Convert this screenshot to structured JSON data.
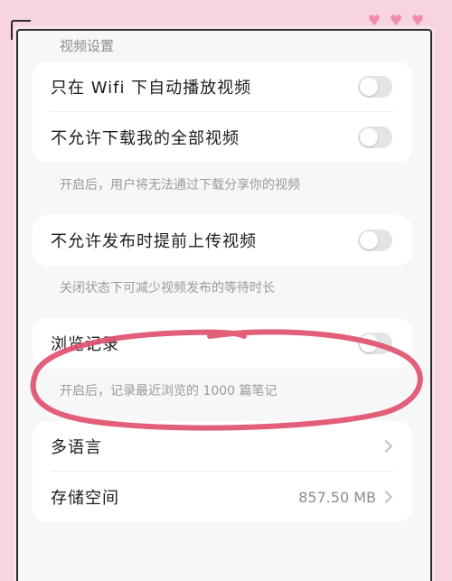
{
  "section_title": "视频设置",
  "card1": {
    "rows": [
      {
        "label": "只在 Wifi 下自动播放视频"
      },
      {
        "label": "不允许下载我的全部视频"
      }
    ]
  },
  "hint1": "开启后，用户将无法通过下载分享你的视频",
  "card2": {
    "rows": [
      {
        "label": "不允许发布时提前上传视频"
      }
    ]
  },
  "hint2": "关闭状态下可减少视频发布的等待时长",
  "card3": {
    "rows": [
      {
        "label": "浏览记录"
      }
    ]
  },
  "hint3": "开启后，记录最近浏览的 1000 篇笔记",
  "card4": {
    "rows": [
      {
        "label": "多语言",
        "value": ""
      },
      {
        "label": "存储空间",
        "value": "857.50 MB"
      }
    ]
  },
  "colors": {
    "background": "#f7d4e0",
    "hearts": "#f08bb0",
    "annotation": "#e0506e"
  }
}
